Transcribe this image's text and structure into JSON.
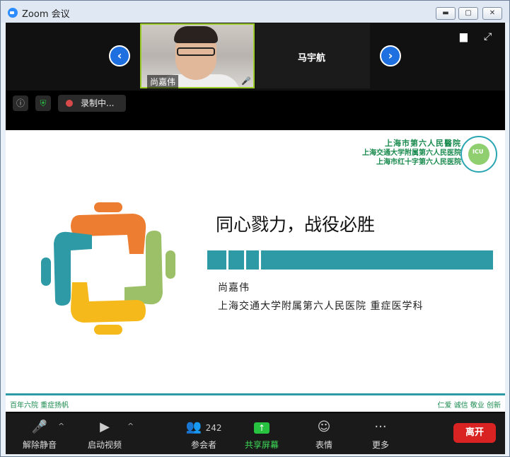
{
  "window": {
    "title": "Zoom 会议",
    "min": "▬",
    "max": "▢",
    "close": "✕"
  },
  "gallery": {
    "prev": "‹",
    "next": "›",
    "participants": [
      {
        "name": "尚嘉伟",
        "mic_icon": "mic-off-icon"
      },
      {
        "name": "马宇航"
      }
    ]
  },
  "status": {
    "info_icon": "info-icon",
    "shield_icon": "shield-check-icon",
    "recording_label": "录制中..."
  },
  "slide": {
    "hospital_logo": [
      "上海市第六人民醫院",
      "上海交通大学附属第六人民医院",
      "上海市红十字第六人民医院"
    ],
    "icu_badge": "ICU",
    "title": "同心戮力，战役必胜",
    "presenter": "尚嘉伟",
    "department": "上海交通大学附属第六人民医院 重症医学科",
    "footer_left": "百年六院 重症扬帆",
    "footer_right": "仁爱 诚信 敬业 创新",
    "colors": {
      "teal": "#2d9aa5",
      "orange": "#ed7d31",
      "green": "#9bc068",
      "yellow": "#f6b91b"
    }
  },
  "controls": {
    "mute": "解除静音",
    "video": "启动视频",
    "participants": "参会者",
    "participant_count": "242",
    "share": "共享屏幕",
    "reactions": "表情",
    "more": "更多",
    "leave": "离开"
  }
}
